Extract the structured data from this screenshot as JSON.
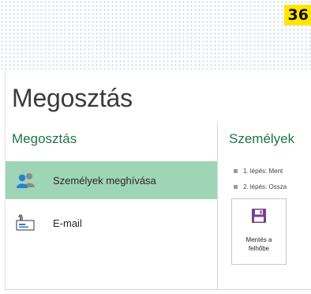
{
  "page_badge": "36",
  "backstage": {
    "title": "Megosztás",
    "left": {
      "heading": "Megosztás",
      "options": [
        {
          "label": "Személyek meghívása",
          "icon": "people-icon",
          "selected": true
        },
        {
          "label": "E-mail",
          "icon": "email-icon",
          "selected": false
        }
      ]
    },
    "right": {
      "heading": "Személyek",
      "steps": [
        "1. lépés: Ment",
        "2. lépés: Ossza"
      ],
      "save_tile": {
        "label": "Mentés a\nfelhőbe",
        "icon": "save-icon"
      }
    }
  },
  "colors": {
    "accent_green": "#217346",
    "selected_background": "#9fd5b7",
    "badge_yellow": "#ffe600"
  }
}
